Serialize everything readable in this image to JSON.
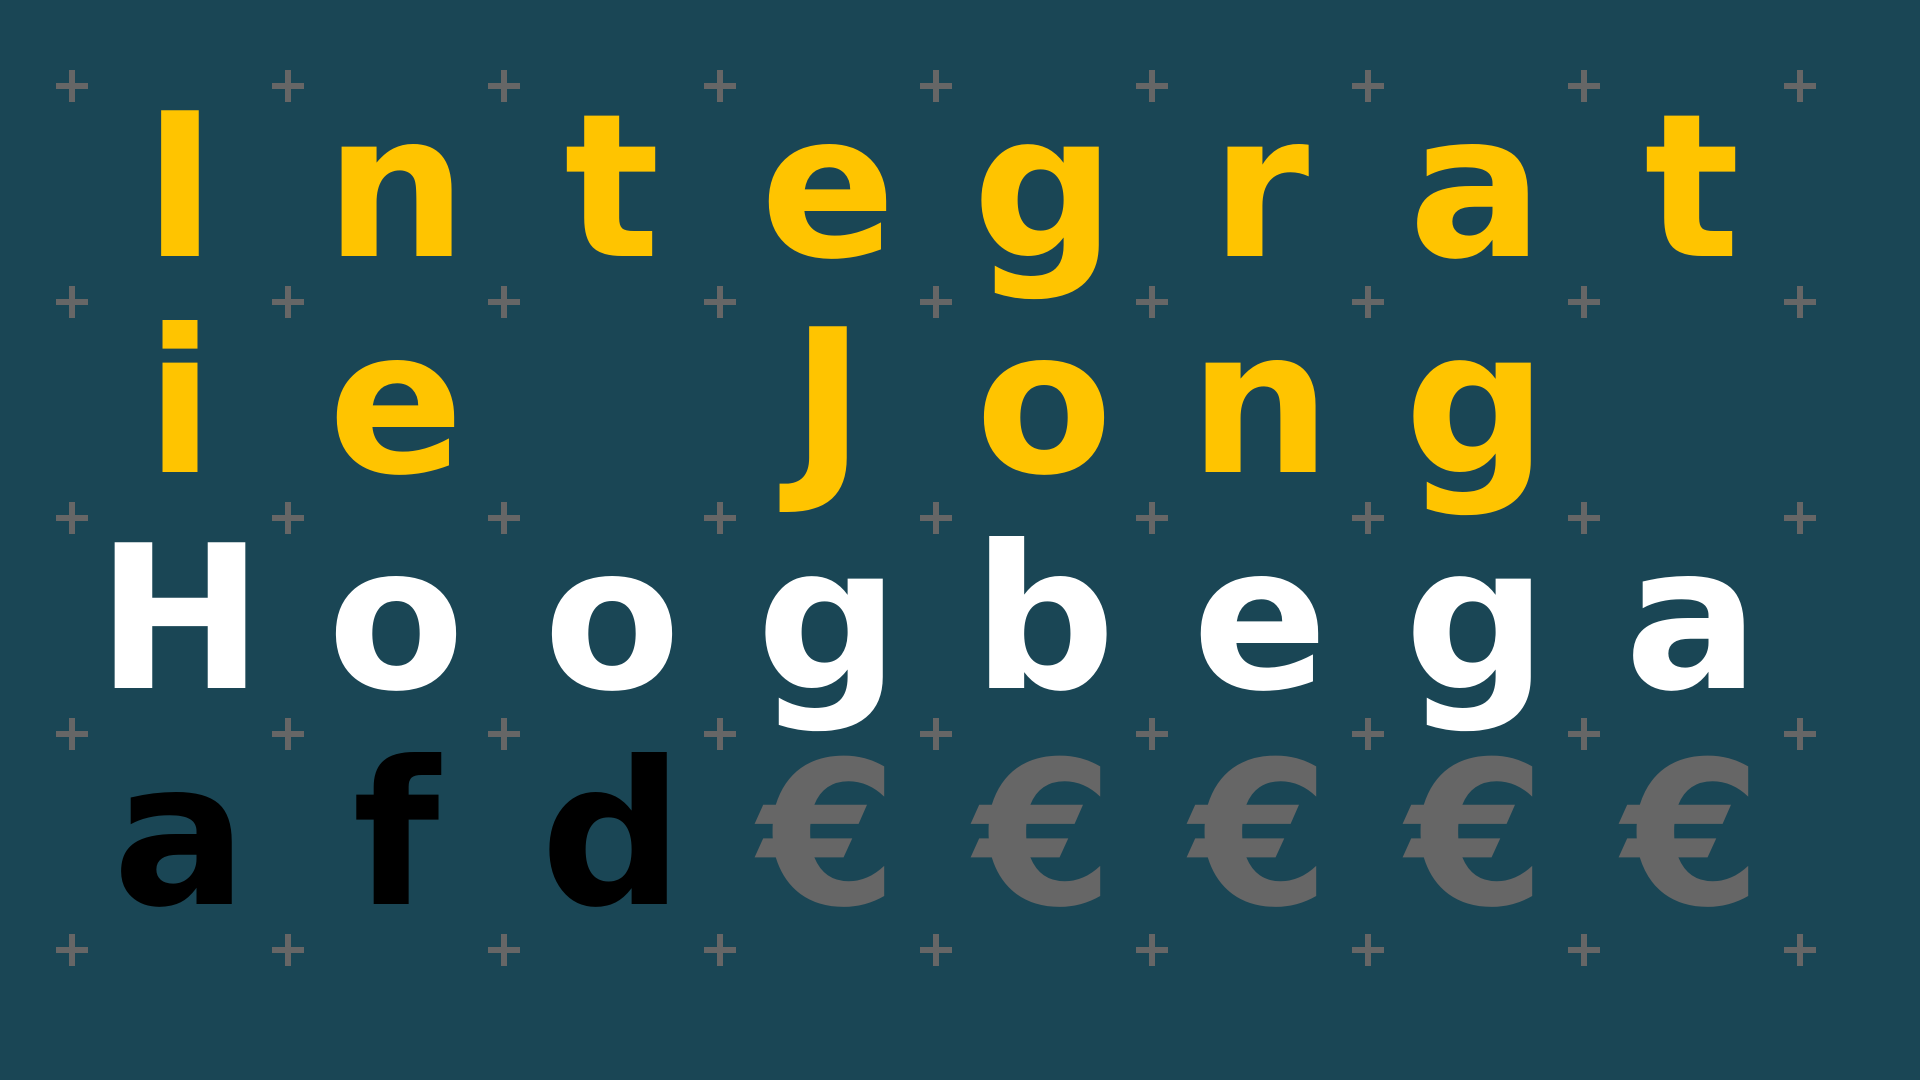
{
  "background_color": "#1a4655",
  "plus_color": "#666666",
  "colors": {
    "yellow": "#ffc400",
    "white": "#ffffff",
    "black": "#000000",
    "gray": "#666666"
  },
  "rows": [
    {
      "color": "#ffc400",
      "letters": [
        "I",
        "n",
        "t",
        "e",
        "g",
        "r",
        "a",
        "t"
      ]
    },
    {
      "color": "#ffc400",
      "letters": [
        "i",
        "e",
        "",
        "J",
        "o",
        "n",
        "g",
        ""
      ]
    },
    {
      "color": "#ffffff",
      "letters": [
        "H",
        "o",
        "o",
        "g",
        "b",
        "e",
        "g",
        "a"
      ]
    },
    {
      "color": "mixed",
      "letters": [
        "a",
        "f",
        "d",
        "€",
        "€",
        "€",
        "€",
        "€"
      ],
      "letter_colors": [
        "#000000",
        "#000000",
        "#000000",
        "#666666",
        "#666666",
        "#666666",
        "#666666",
        "#666666"
      ]
    }
  ]
}
